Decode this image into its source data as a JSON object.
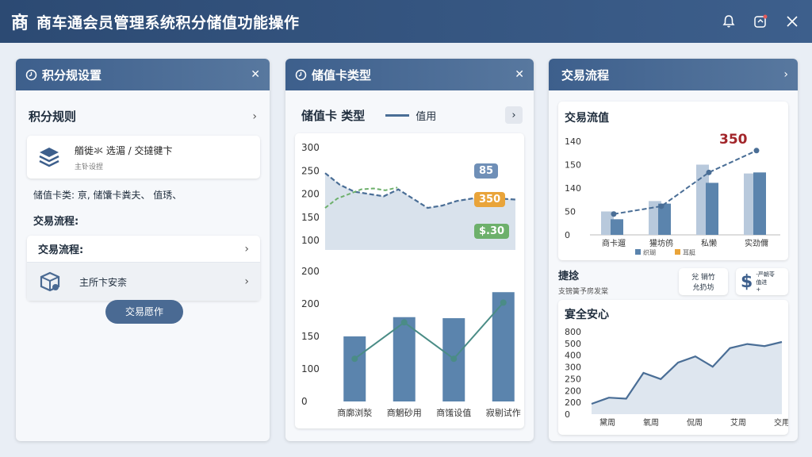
{
  "window": {
    "logo": "商",
    "title": "商车通会员管理系统积分储值功能操作"
  },
  "icons": {
    "bell": "bell-icon",
    "notify": "notification-icon",
    "close": "close-icon"
  },
  "panel1": {
    "title": "积分规设置",
    "rules_title": "积分规则",
    "rule_card_line1": "艏徙氺  选湄 / 交撻徤卞",
    "rule_card_line2": "主钋设捏",
    "card_type_line": "储值卡类:  亰, 储馕卡粪夫、 值琇、",
    "flow_label": "交易流程:",
    "flow_card_title": "交易流程:",
    "flow_card_item": "主所卞安柰",
    "action_button": "交易愿作"
  },
  "panel2": {
    "title": "储值卡类型",
    "subtitle": "储值卡 类型",
    "legend": "值用",
    "tags": [
      "85",
      "350",
      "$.30"
    ],
    "chart_data": [
      {
        "type": "area",
        "y_ticks": [
          300,
          250,
          200,
          150,
          100
        ],
        "ylim": [
          100,
          300
        ],
        "series": [
          {
            "values": [
              245,
              220,
              205,
              200,
              195,
              210,
              190,
              170,
              175,
              185,
              190,
              195,
              190,
              188
            ]
          },
          {
            "values": [
              170,
              190,
              200,
              210,
              212,
              208,
              214
            ]
          }
        ]
      },
      {
        "type": "bar",
        "categories": [
          "商廓浏湬",
          "商魍砂用",
          "商馐设值",
          "寂剔试作"
        ],
        "values": [
          125,
          162,
          160,
          210
        ],
        "line_values": [
          82,
          152,
          82,
          190
        ],
        "y_ticks": [
          200,
          200,
          150,
          100,
          0
        ],
        "ylim": [
          0,
          250
        ]
      }
    ]
  },
  "panel3": {
    "title": "交易流程",
    "chart1_title": "交易流值",
    "chart1_peak": "350",
    "legend": [
      "织瑚",
      "耳艇"
    ],
    "section_title": "捷捻",
    "section_sub": "支镑簧予房发棠",
    "btn1": "兊 销竹\n允扔坊",
    "btn2": "$",
    "btn2_sub": "-严朝苓\n值进\n+",
    "chart2_title": "宴全安心",
    "chart_data": [
      {
        "type": "bar",
        "categories": [
          "商卡遛",
          "獾坊鸧",
          "私懒",
          "实劲儞"
        ],
        "y_ticks": [
          140,
          150,
          140,
          50,
          0
        ],
        "series": [
          {
            "values": [
              45,
              65,
              135,
              118
            ]
          },
          {
            "values": [
              30,
              60,
              100,
              120
            ]
          }
        ],
        "line_values": [
          40,
          55,
          120,
          162
        ],
        "ylim": [
          0,
          180
        ]
      },
      {
        "type": "area",
        "categories": [
          "黛周",
          "氧周",
          "侃周",
          "艾周",
          "交用"
        ],
        "y_ticks": [
          800,
          500,
          400,
          300,
          250,
          200,
          200,
          0
        ],
        "values": [
          200,
          230,
          225,
          350,
          320,
          400,
          430,
          380,
          470,
          490,
          480,
          500
        ],
        "ylim": [
          150,
          550
        ]
      }
    ]
  },
  "colors": {
    "header": "#3d5f8c",
    "bar": "#5b84ad",
    "bar_light": "#b8c9dc",
    "line": "#4a6e96",
    "green": "#6db06b",
    "orange": "#e9a43a",
    "tag_blue": "#6f8fb7",
    "peak_red": "#a2252a"
  }
}
